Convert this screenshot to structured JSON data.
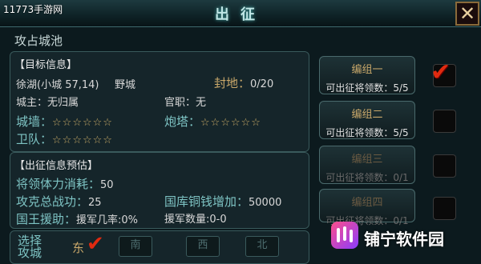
{
  "watermark": "11773手游网",
  "window": {
    "title": "出征",
    "close_glyph": "✕"
  },
  "subtitle": "攻占城池",
  "target": {
    "header": "【目标信息】",
    "city": "徐湖(小城 57,14)",
    "city_type": "野城",
    "fief_label": "封地：",
    "fief_value": "0/20",
    "owner": "城主：无归属",
    "office": "官职：无",
    "wall_label": "城墙：",
    "tower_label": "炮塔：",
    "guard_label": "卫队：",
    "stars": "☆☆☆☆☆☆"
  },
  "estimate": {
    "header": "【出征信息预估】",
    "stamina_label": "将领体力消耗：",
    "stamina_value": "50",
    "attack_label": "攻克总战功：",
    "attack_value": "25",
    "copper_label": "国库铜钱增加：",
    "copper_value": "50000",
    "aid_label": "国王援助：",
    "aid_rate": "援军几率:0%",
    "aid_count": "援军数量:0-0"
  },
  "direction": {
    "label": "选择攻城",
    "east": "东",
    "south": "南",
    "west": "西",
    "north": "北"
  },
  "groups": [
    {
      "name": "编组一",
      "info": "可出征将领数：5/5",
      "checked": true
    },
    {
      "name": "编组二",
      "info": "可出征将领数：5/5",
      "checked": false
    },
    {
      "name": "编组三",
      "info": "可出征将领数：0/1",
      "checked": false
    },
    {
      "name": "编组四",
      "info": "可出征将领数：0/1",
      "checked": false
    }
  ],
  "brand": "铺宁软件园",
  "colors": {
    "accent": "#7ec4c4",
    "gold": "#c9a86a",
    "check": "#e02a10"
  },
  "icons": {
    "close": "close-icon",
    "check": "checkmark-icon",
    "logo": "brand-logo-icon"
  }
}
